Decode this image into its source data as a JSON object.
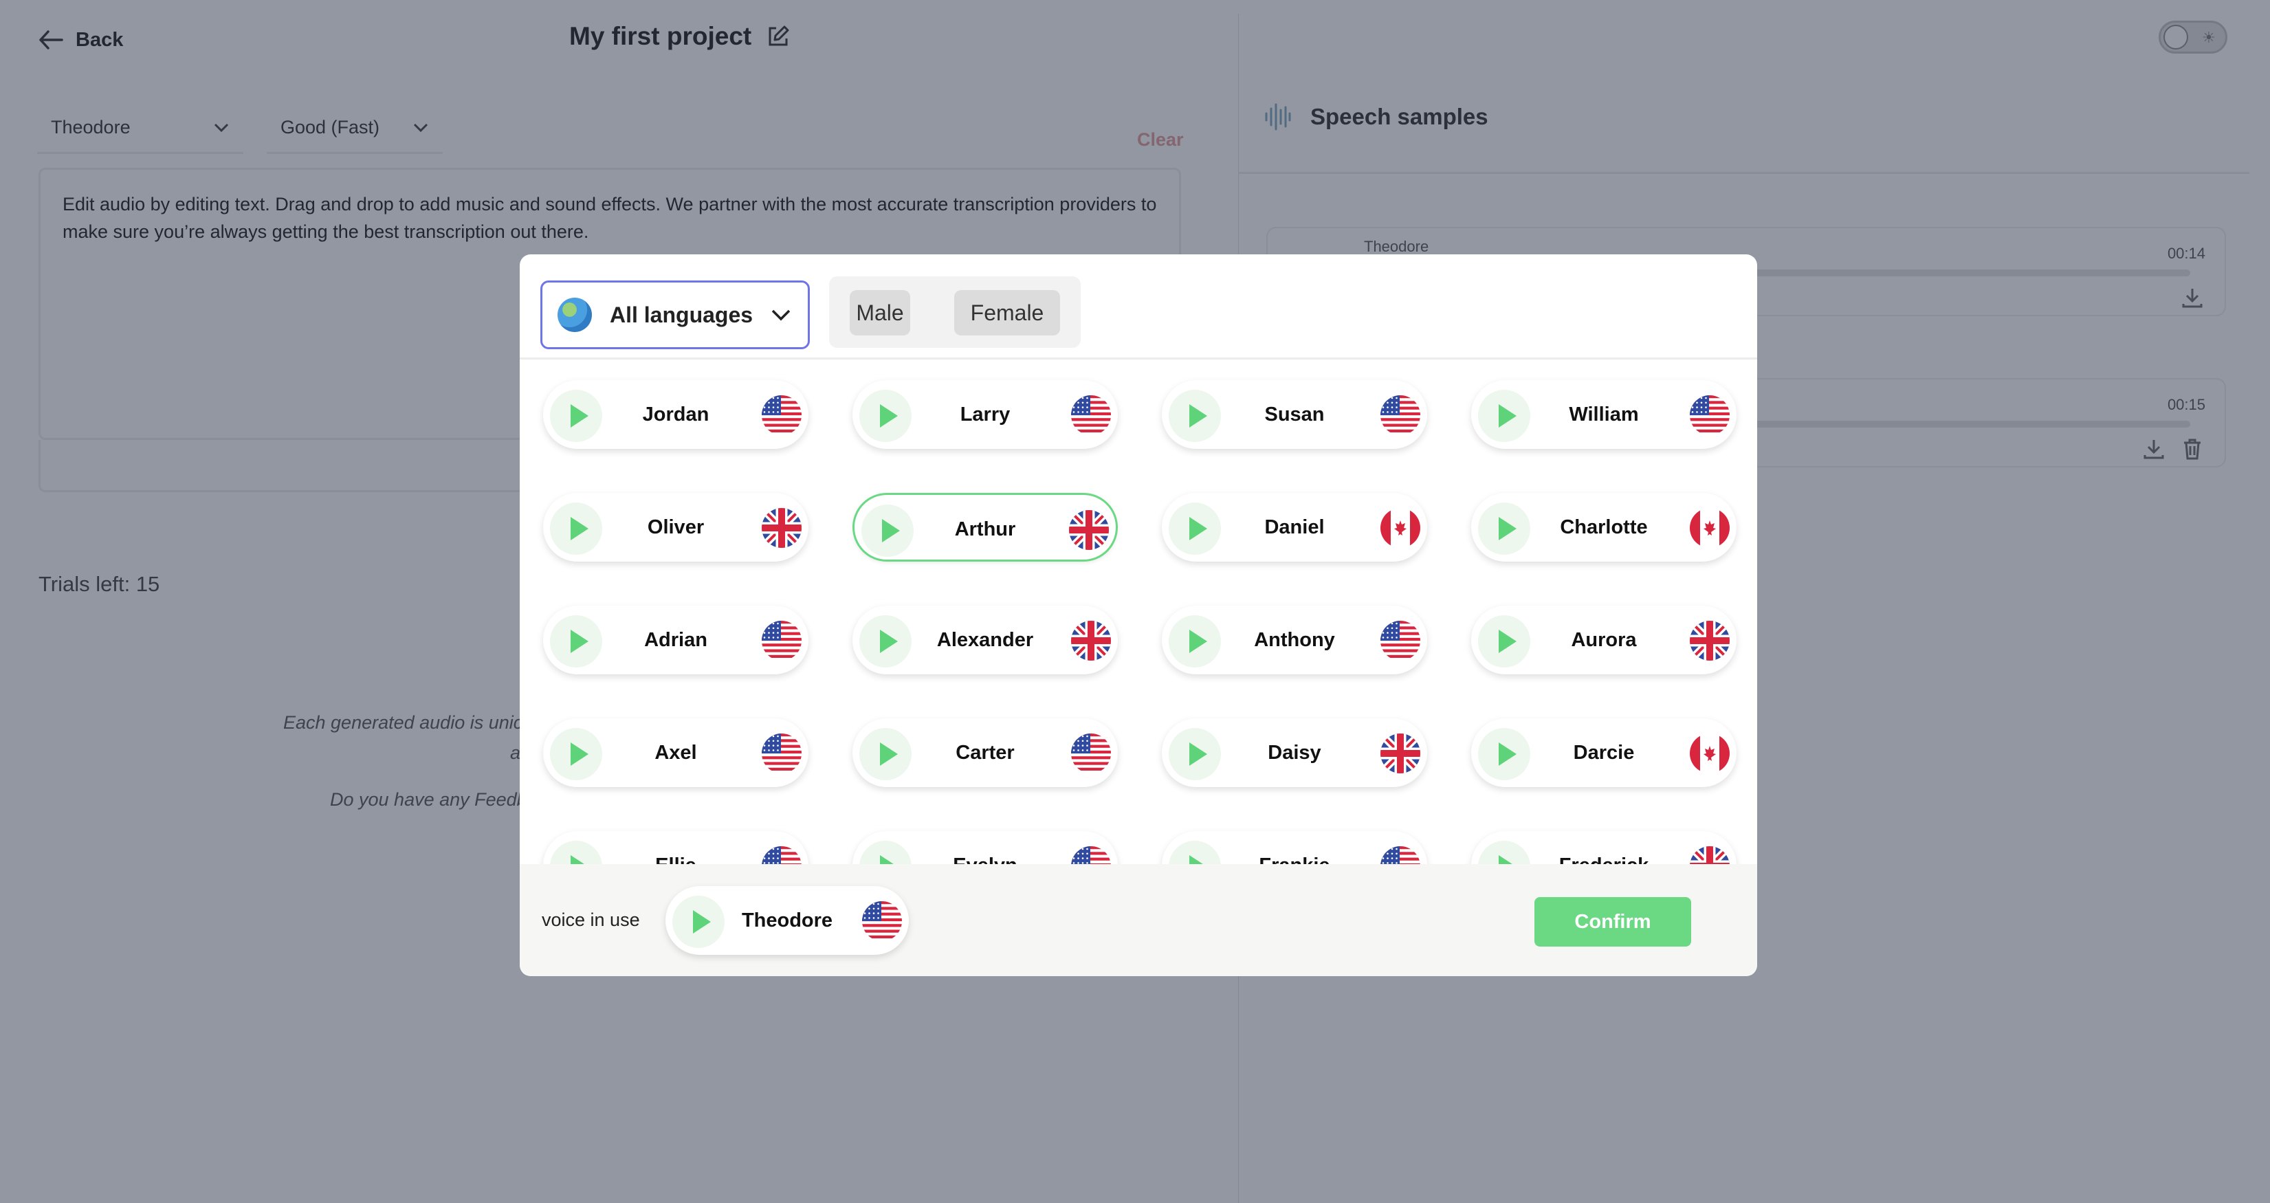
{
  "header": {
    "back_label": "Back",
    "project_title": "My first project"
  },
  "toolbar": {
    "voice_select": "Theodore",
    "quality_select": "Good (Fast)",
    "clear_label": "Clear"
  },
  "editor": {
    "text": "Edit audio by editing text. Drag and drop to add music and sound effects. We partner with the most accurate transcription providers to make sure you’re always getting the best transcription out there."
  },
  "status": {
    "trials_left": "Trials left: 15",
    "info_line1": "Each generated audio is unic",
    "info_line1b": "a",
    "info_line2": "Do you have any Feedb"
  },
  "right_panel": {
    "title": "Speech samples",
    "samples": [
      {
        "name": "Theodore",
        "duration": "00:14"
      },
      {
        "name": "",
        "duration": "00:15"
      }
    ]
  },
  "modal": {
    "language_filter": "All languages",
    "gender": {
      "male": "Male",
      "female": "Female"
    },
    "voices": [
      {
        "name": "Jordan",
        "flag": "us"
      },
      {
        "name": "Larry",
        "flag": "us"
      },
      {
        "name": "Susan",
        "flag": "us"
      },
      {
        "name": "William",
        "flag": "us"
      },
      {
        "name": "Oliver",
        "flag": "uk"
      },
      {
        "name": "Arthur",
        "flag": "uk",
        "selected": true
      },
      {
        "name": "Daniel",
        "flag": "ca"
      },
      {
        "name": "Charlotte",
        "flag": "ca"
      },
      {
        "name": "Adrian",
        "flag": "us"
      },
      {
        "name": "Alexander",
        "flag": "uk"
      },
      {
        "name": "Anthony",
        "flag": "us"
      },
      {
        "name": "Aurora",
        "flag": "uk"
      },
      {
        "name": "Axel",
        "flag": "us"
      },
      {
        "name": "Carter",
        "flag": "us"
      },
      {
        "name": "Daisy",
        "flag": "uk"
      },
      {
        "name": "Darcie",
        "flag": "ca"
      },
      {
        "name": "Ellie",
        "flag": "us"
      },
      {
        "name": "Evelyn",
        "flag": "us"
      },
      {
        "name": "Frankie",
        "flag": "us"
      },
      {
        "name": "Frederick",
        "flag": "uk"
      }
    ],
    "voice_in_use_label": "voice in use",
    "voice_in_use": {
      "name": "Theodore",
      "flag": "us"
    },
    "confirm_label": "Confirm"
  },
  "colors": {
    "accent_green": "#6bd884",
    "dropdown_border": "#6f74e6",
    "clear_red": "#e6a6a6"
  }
}
